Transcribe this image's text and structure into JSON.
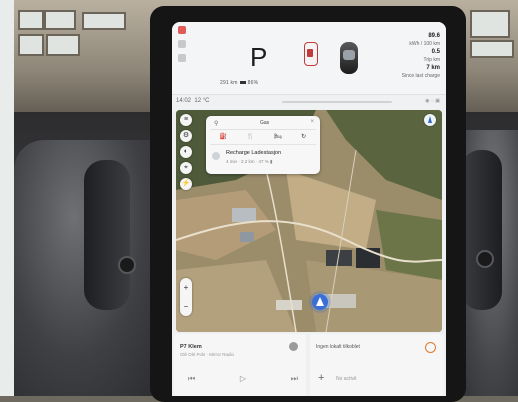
{
  "scene": {
    "colors": {
      "wall": "#dfe4e1",
      "dash": "#2c2c2e",
      "bezel": "#151515",
      "screen": "#eef0f2"
    }
  },
  "header": {
    "gear": "P",
    "range": "291 km",
    "battery": "86%",
    "right_lines": [
      {
        "value": "89.6",
        "label": "kWh / 100 km"
      },
      {
        "value": "0.5",
        "label": "Trip km"
      },
      {
        "value": "7 km",
        "label": "Since last charge"
      }
    ]
  },
  "status_bar": {
    "time": "14:02",
    "temp": "12 °C",
    "icons": "◉ ◌ ▣"
  },
  "map": {
    "search_label": "Gas",
    "categories": [
      "⛽",
      "🍴",
      "🛏",
      "↻"
    ],
    "result_title": "Recharge Ladestasjon",
    "result_sub": "4 min · 2.2 km · 47 % ▮"
  },
  "media": {
    "title": "P7 Klem",
    "subtitle": "Olé Olé Pols · Mirror Radio",
    "controls": [
      "⏮",
      "▷",
      "⏭"
    ]
  },
  "panel": {
    "title": "Ingen lokalt tilkoblet",
    "add_label": "+",
    "hint": "No activit"
  },
  "dock": {
    "colors": [
      "#d9443b",
      "#e8624a",
      "#2fa84f",
      "#4a8fe0",
      "#ececec",
      "#ececec",
      "#ececec"
    ]
  }
}
